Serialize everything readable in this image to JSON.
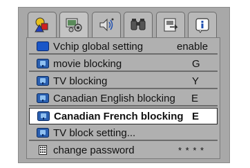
{
  "tabs": [
    {
      "icon": "color-shapes-icon",
      "active": false
    },
    {
      "icon": "settings-icon",
      "active": true
    },
    {
      "icon": "speaker-icon",
      "active": false
    },
    {
      "icon": "binoculars-icon",
      "active": false
    },
    {
      "icon": "source-input-icon",
      "active": false
    },
    {
      "icon": "info-icon",
      "active": false
    }
  ],
  "menu": {
    "items": [
      {
        "label": "Vchip global setting",
        "value": "enable",
        "icon": "screen-icon"
      },
      {
        "label": "movie blocking",
        "value": "G",
        "icon": "tv-icon"
      },
      {
        "label": "TV blocking",
        "value": "Y",
        "icon": "tv-icon"
      },
      {
        "label": "Canadian English blocking",
        "value": "E",
        "icon": "tv-icon"
      },
      {
        "label": "Canadian French blocking",
        "value": "E",
        "icon": "tv-icon",
        "selected": true
      },
      {
        "label": "TV block setting...",
        "value": "",
        "icon": "tv-icon"
      },
      {
        "label": "change password",
        "value": "* * * *",
        "icon": "keypad-icon"
      }
    ]
  },
  "colors": {
    "screen_blue": "#1a56c8",
    "tv_blue": "#2a5fb0",
    "selected_bg": "#ffffff"
  }
}
